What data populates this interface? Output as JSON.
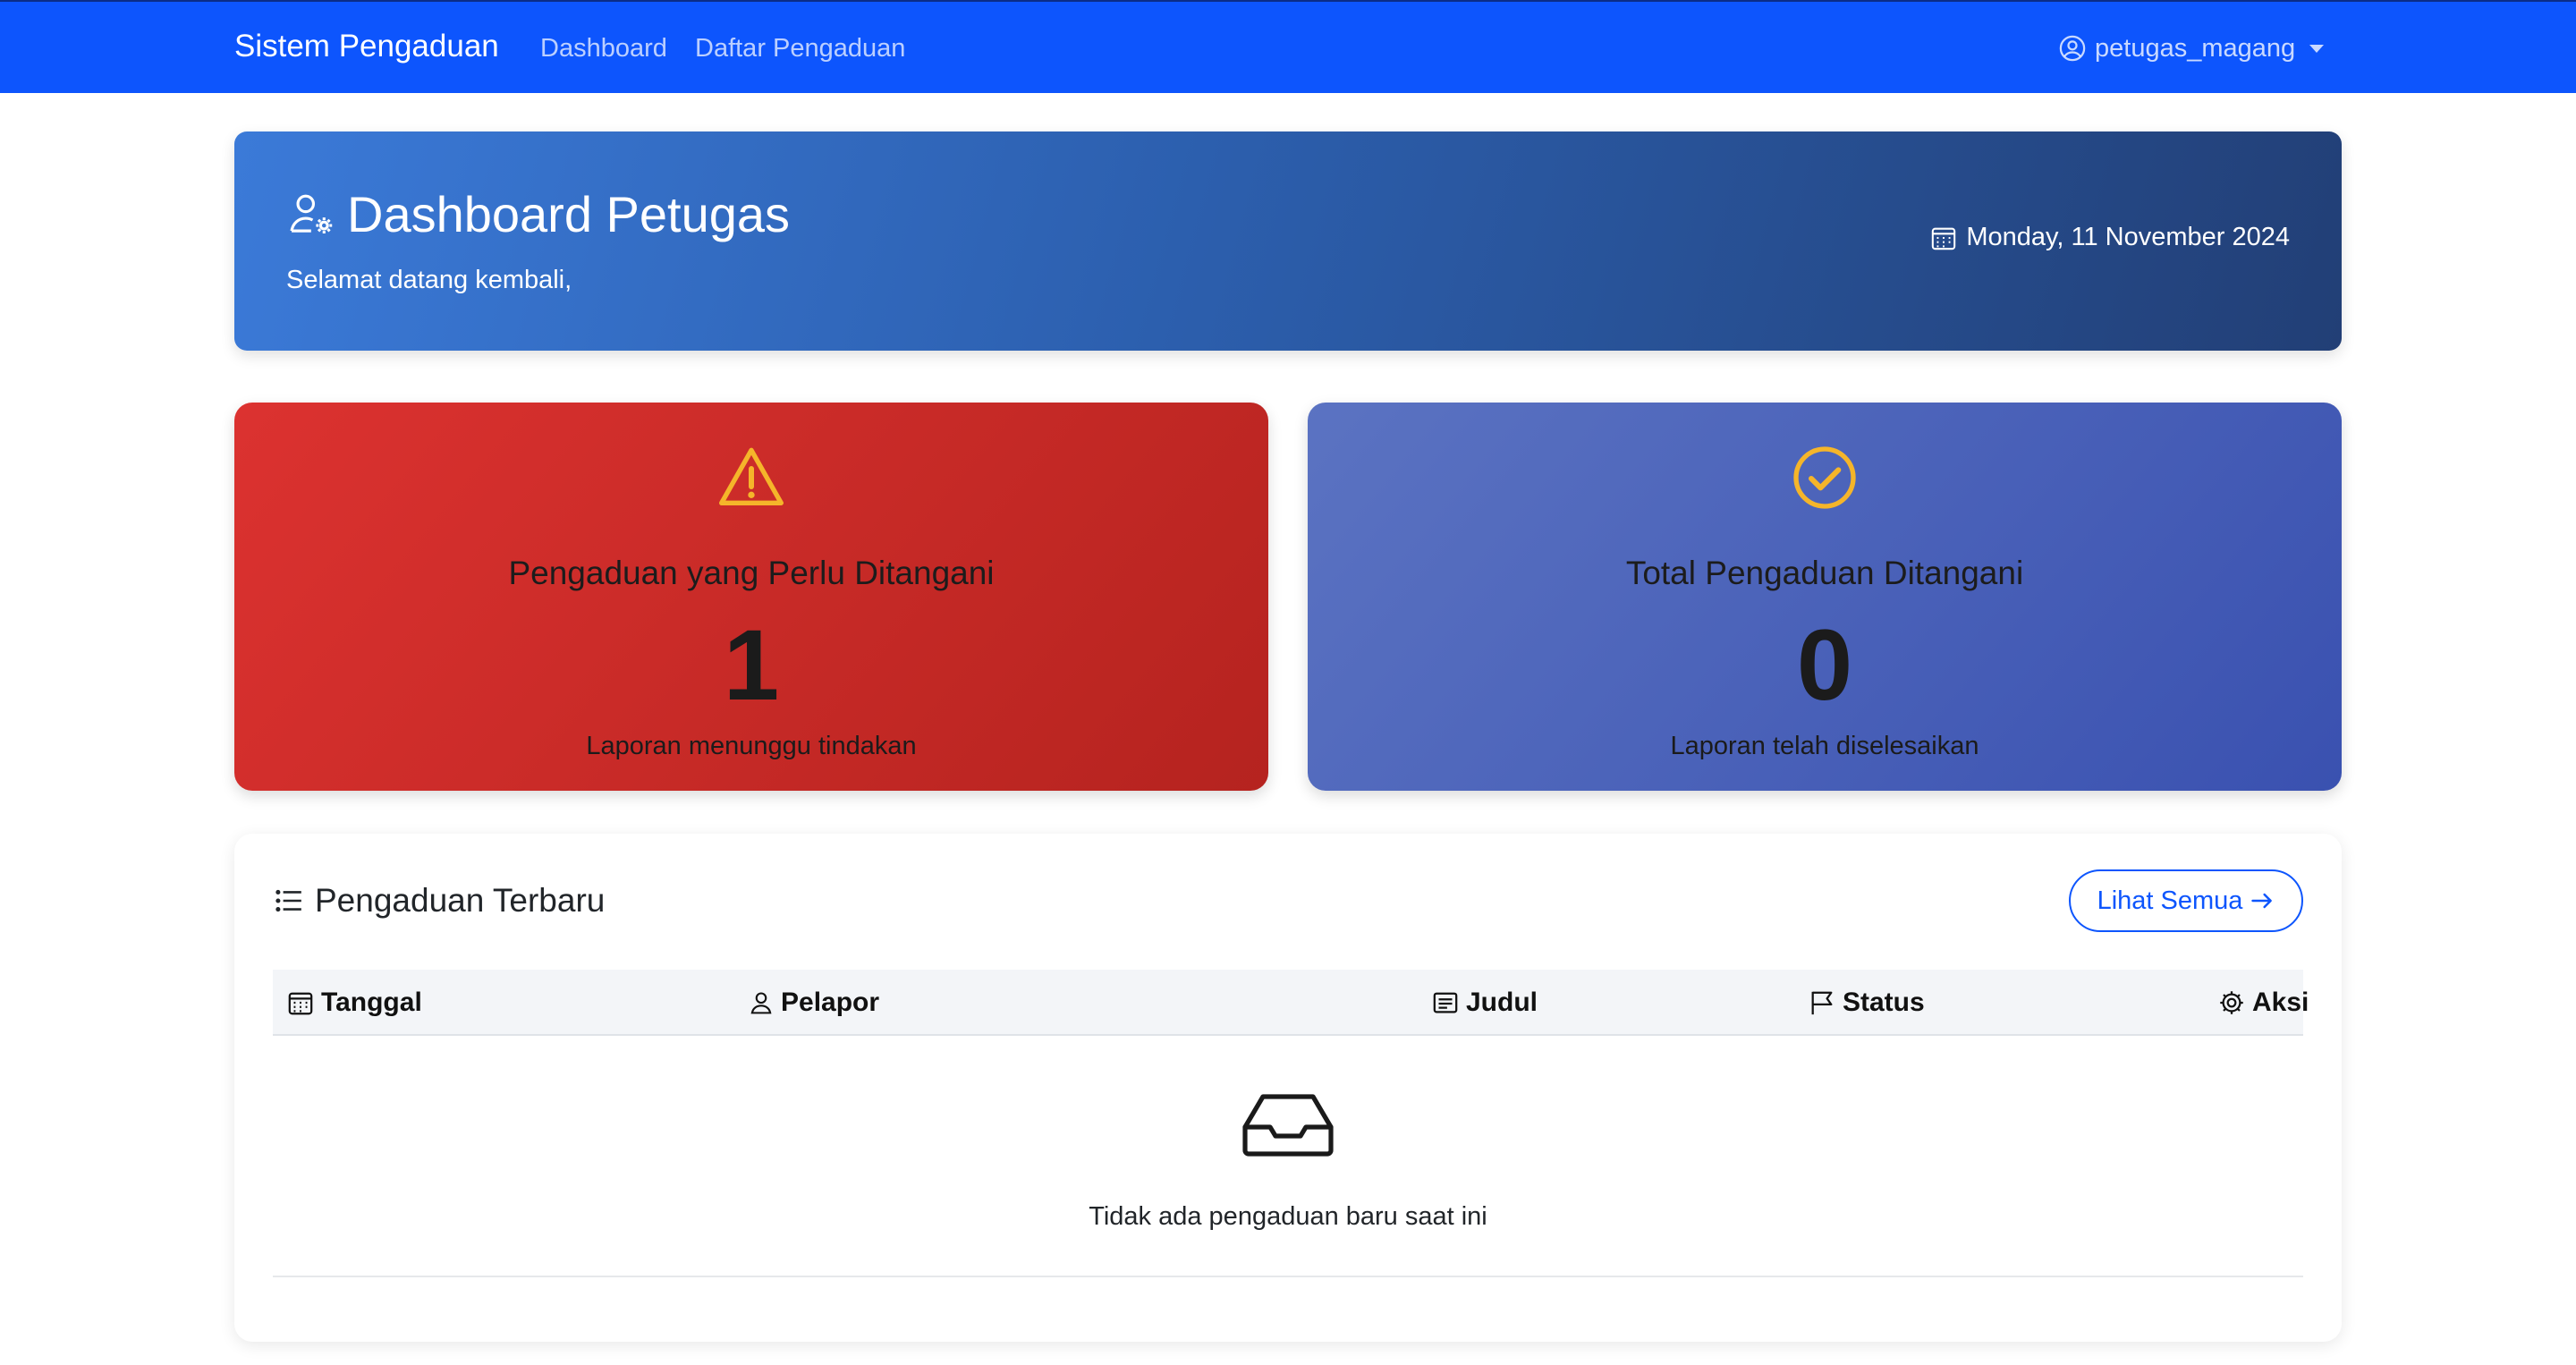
{
  "navbar": {
    "brand": "Sistem Pengaduan",
    "links": [
      {
        "label": "Dashboard"
      },
      {
        "label": "Daftar Pengaduan"
      }
    ],
    "user": {
      "icon": "user-circle-icon",
      "name": "petugas_magang"
    },
    "bg_color": "#0d55fd"
  },
  "hero": {
    "icon": "user-gear-icon",
    "title": "Dashboard Petugas",
    "subtitle": "Selamat datang kembali,",
    "date_icon": "calendar-icon",
    "date": "Monday, 11 November 2024"
  },
  "stats": [
    {
      "icon": "warning-triangle-icon",
      "title": "Pengaduan yang Perlu Ditangani",
      "value": "1",
      "description": "Laporan menunggu tindakan",
      "color": "#dc3230"
    },
    {
      "icon": "check-circle-icon",
      "title": "Total Pengaduan Ditangani",
      "value": "0",
      "description": "Laporan telah diselesaikan",
      "color": "#4a62bb"
    }
  ],
  "recent": {
    "icon": "list-icon",
    "title": "Pengaduan Terbaru",
    "view_all_label": "Lihat Semua",
    "columns": [
      {
        "icon": "calendar-icon",
        "label": "Tanggal"
      },
      {
        "icon": "person-icon",
        "label": "Pelapor"
      },
      {
        "icon": "document-icon",
        "label": "Judul"
      },
      {
        "icon": "flag-icon",
        "label": "Status"
      },
      {
        "icon": "gear-icon",
        "label": "Aksi"
      }
    ],
    "empty_icon": "inbox-icon",
    "empty_text": "Tidak ada pengaduan baru saat ini"
  }
}
